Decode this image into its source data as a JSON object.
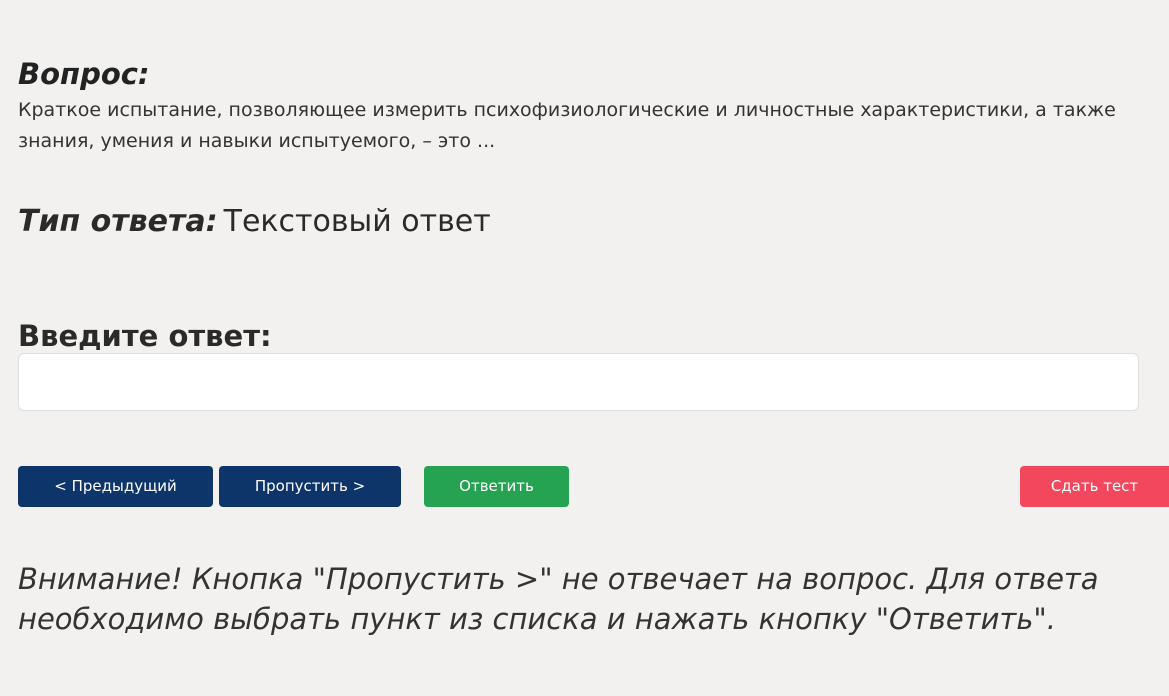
{
  "question": {
    "heading": "Вопрос:",
    "text": "Краткое испытание, позволяющее измерить психофизиологические и личностные характеристики, а также знания, умения и навыки испытуемого, – это ..."
  },
  "answer_type": {
    "label": "Тип ответа:",
    "value": "Текстовый ответ"
  },
  "answer_input": {
    "label": "Введите ответ:",
    "value": "",
    "placeholder": ""
  },
  "buttons": {
    "previous": "< Предыдущий",
    "skip": "Пропустить >",
    "answer": "Ответить",
    "finish": "Сдать тест"
  },
  "notice": "Внимание! Кнопка \"Пропустить >\" не отвечает на вопрос. Для ответа необходимо выбрать пункт из списка и нажать кнопку \"Ответить\".",
  "colors": {
    "background": "#f2f1ef",
    "navigation_button": "#0d3569",
    "answer_button": "#25a353",
    "finish_button": "#f2475c"
  }
}
